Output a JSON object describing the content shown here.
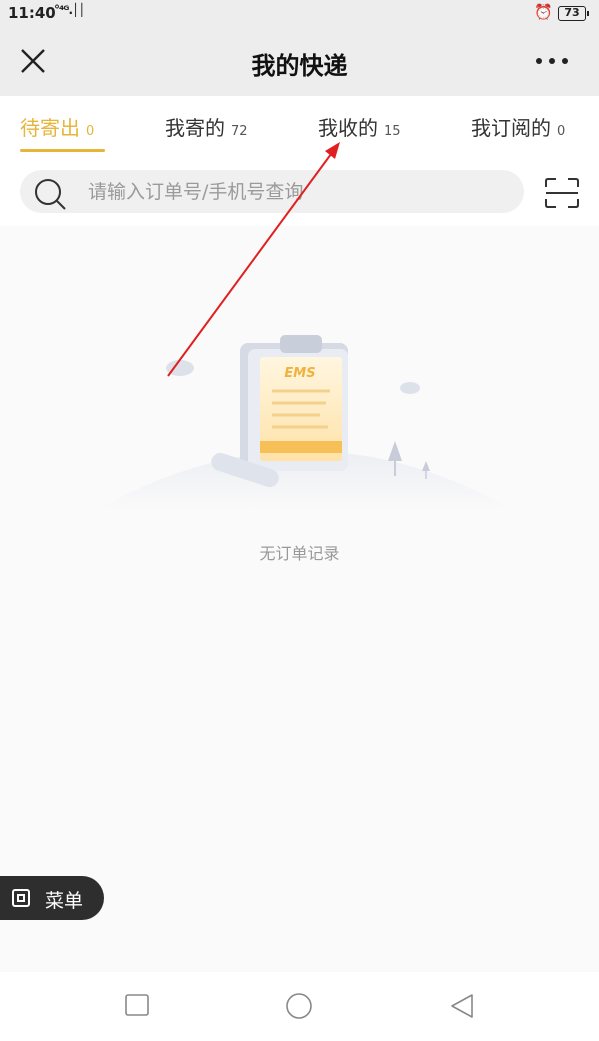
{
  "statusbar": {
    "time": "11:40",
    "signal": "°⁴ᴳ.││",
    "battery": "73",
    "alarm_icon": "alarm-clock-icon"
  },
  "header": {
    "title": "我的快递",
    "close_icon": "close-icon",
    "more_icon": "more-dots-icon"
  },
  "tabs": [
    {
      "label": "待寄出",
      "count": "0"
    },
    {
      "label": "我寄的",
      "count": "72"
    },
    {
      "label": "我收的",
      "count": "15"
    },
    {
      "label": "我订阅的",
      "count": "0"
    }
  ],
  "search": {
    "placeholder": "请输入订单号/手机号查询",
    "value": ""
  },
  "empty": {
    "illustration_label": "EMS",
    "text": "无订单记录"
  },
  "menu": {
    "label": "菜单"
  },
  "colors": {
    "accent": "#e6b53a",
    "annotation_arrow": "#e02020"
  }
}
